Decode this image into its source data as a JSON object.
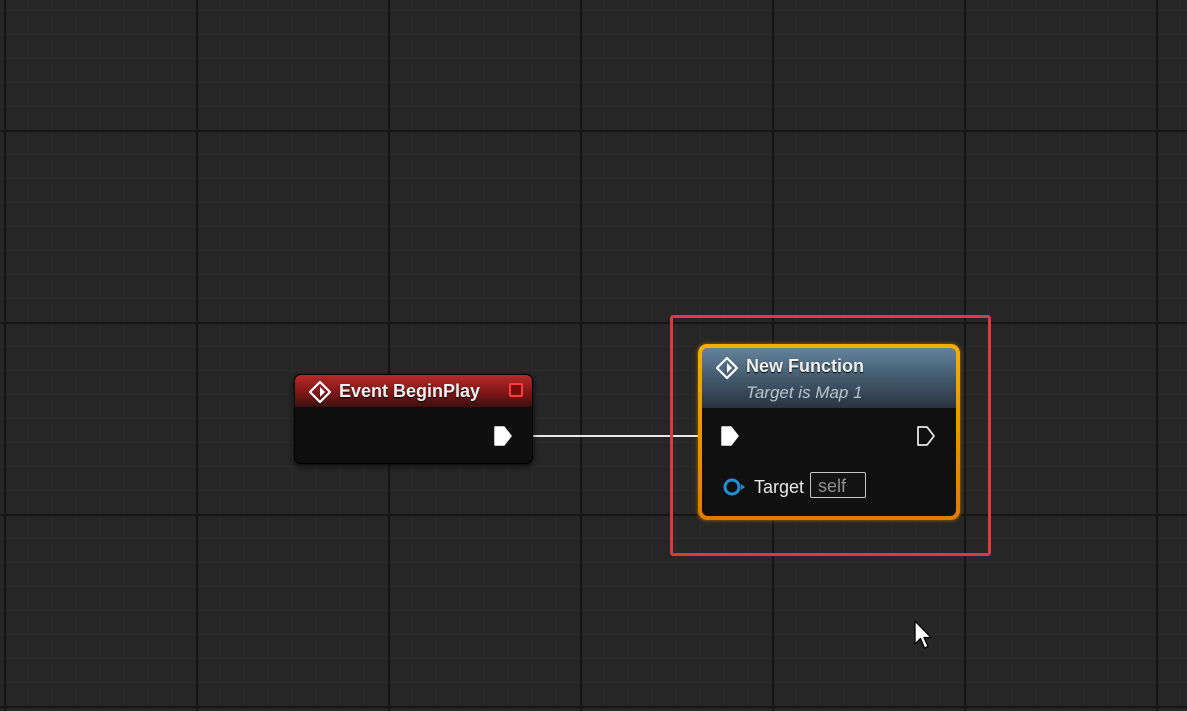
{
  "graph": {
    "background_color": "#262626"
  },
  "event_node": {
    "title": "Event BeginPlay",
    "icon": "event-diamond-icon",
    "header_color": "#8f1d1d",
    "exec_out_pin": "exec-output-pin"
  },
  "function_node": {
    "title": "New Function",
    "subtitle": "Target is Map 1",
    "icon": "function-diamond-icon",
    "header_color": "#4b6478",
    "selected": true,
    "selection_color": "#f0a000",
    "exec_in_pin": "exec-input-pin",
    "exec_out_pin": "exec-output-pin",
    "target_pin": {
      "label": "Target",
      "value": "self",
      "pin_color": "#1e8fd6"
    }
  },
  "highlight": {
    "color": "#e0393b"
  },
  "cursor": {
    "icon": "mouse-pointer-icon"
  }
}
